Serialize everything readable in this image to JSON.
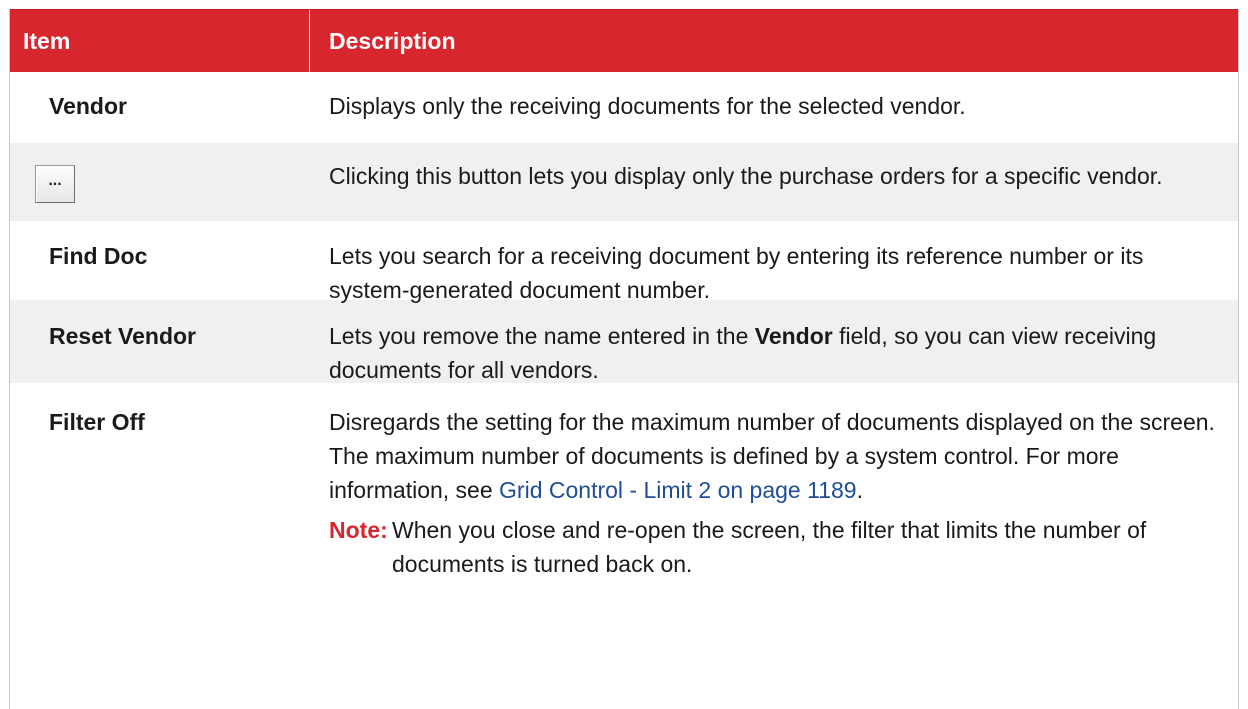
{
  "header": {
    "item_label": "Item",
    "description_label": "Description"
  },
  "rows": [
    {
      "item": "Vendor",
      "description": "Displays only the receiving documents for the selected vendor."
    },
    {
      "button_label": "...",
      "description": "Clicking this button lets you display only the purchase orders for a specific vendor."
    },
    {
      "item": "Find Doc",
      "description": "Lets you search for a receiving document by entering its reference number or its system-generated document number."
    },
    {
      "item": "Reset Vendor",
      "description_before": "Lets you remove the name entered in the ",
      "description_bold": "Vendor",
      "description_after": " field, so you can view receiving documents for all vendors."
    },
    {
      "item": "Filter Off",
      "description_before": "Disregards the setting for the maximum number of documents displayed on the screen. The maximum number of documents is defined by a system control. For more information, see ",
      "link_text": "Grid Control - Limit 2 on page 1189",
      "description_after": ".",
      "note_label": "Note:",
      "note_text": "When you close and re-open the screen, the filter that limits the number of documents is turned back on."
    }
  ],
  "colors": {
    "header_background": "#d8262f",
    "alt_row_background": "#f0f0f0",
    "link": "#1f4e96",
    "note_label": "#d8262f"
  }
}
